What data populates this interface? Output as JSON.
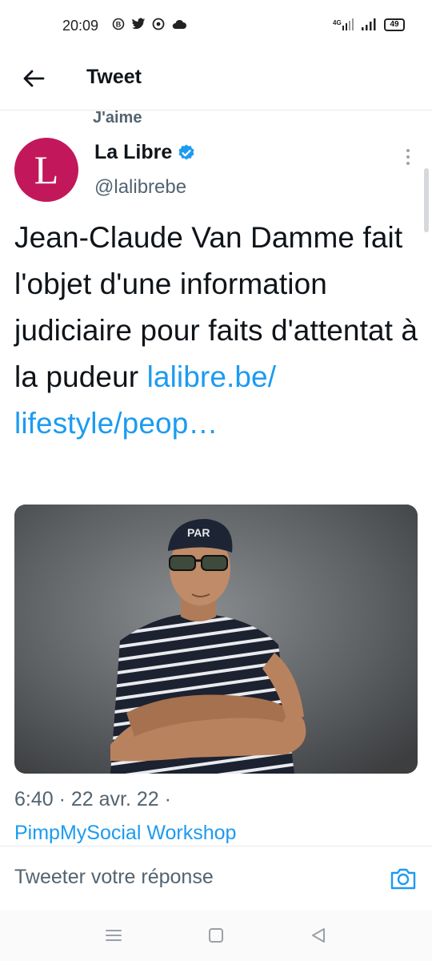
{
  "status_bar": {
    "time": "20:09",
    "network": "4G",
    "battery": "49"
  },
  "header": {
    "title": "Tweet"
  },
  "social_context": "J'aime",
  "author": {
    "avatar_letter": "L",
    "name": "La Libre",
    "handle": "@lalibrebe",
    "verified": true
  },
  "tweet": {
    "text": "Jean-Claude Van Damme fait l'objet d'une information judiciaire pour faits d'attentat à la pudeur",
    "link": "lalibre.be/ lifestyle/peop…"
  },
  "meta": {
    "time_date": "6:40 · 22 avr. 22 ·",
    "source": "PimpMySocial Workshop"
  },
  "reply": {
    "placeholder": "Tweeter votre réponse"
  },
  "colors": {
    "accent": "#1d9bf0",
    "avatar_bg": "#c2185b",
    "secondary_text": "#536471"
  }
}
